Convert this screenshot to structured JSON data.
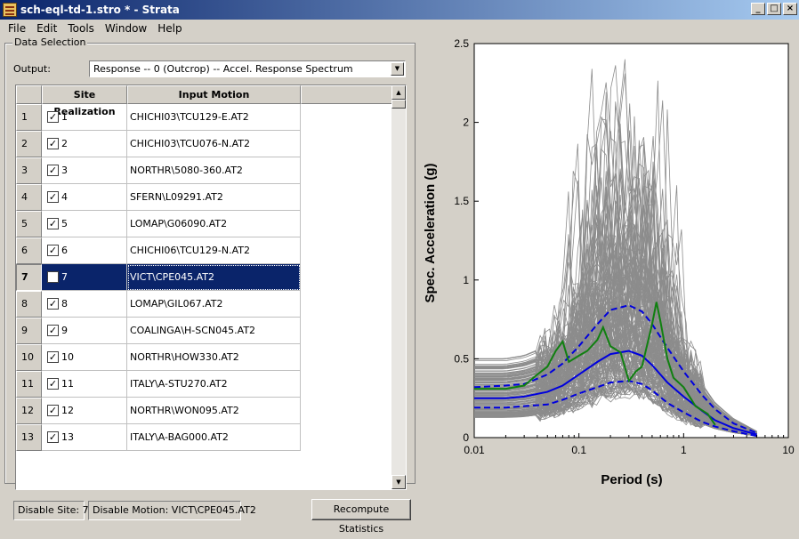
{
  "window": {
    "title": "sch-eql-td-1.stro * - Strata",
    "min": "_",
    "max": "□",
    "close": "×"
  },
  "menu": [
    "File",
    "Edit",
    "Tools",
    "Window",
    "Help"
  ],
  "data_selection": {
    "group_title": "Data Selection",
    "output_label": "Output:",
    "output_value": "Response -- 0 (Outcrop) -- Accel. Response Spectrum",
    "columns": [
      "Site Realization",
      "Input Motion"
    ],
    "rows": [
      {
        "n": "1",
        "site": "1",
        "motion": "CHICHI03\\TCU129-E.AT2",
        "checked": true
      },
      {
        "n": "2",
        "site": "2",
        "motion": "CHICHI03\\TCU076-N.AT2",
        "checked": true
      },
      {
        "n": "3",
        "site": "3",
        "motion": "NORTHR\\5080-360.AT2",
        "checked": true
      },
      {
        "n": "4",
        "site": "4",
        "motion": "SFERN\\L09291.AT2",
        "checked": true
      },
      {
        "n": "5",
        "site": "5",
        "motion": "LOMAP\\G06090.AT2",
        "checked": true
      },
      {
        "n": "6",
        "site": "6",
        "motion": "CHICHI06\\TCU129-N.AT2",
        "checked": true
      },
      {
        "n": "7",
        "site": "7",
        "motion": "VICT\\CPE045.AT2",
        "checked": true,
        "selected": true
      },
      {
        "n": "8",
        "site": "8",
        "motion": "LOMAP\\GIL067.AT2",
        "checked": true
      },
      {
        "n": "9",
        "site": "9",
        "motion": "COALINGA\\H-SCN045.AT2",
        "checked": true
      },
      {
        "n": "10",
        "site": "10",
        "motion": "NORTHR\\HOW330.AT2",
        "checked": true
      },
      {
        "n": "11",
        "site": "11",
        "motion": "ITALY\\A-STU270.AT2",
        "checked": true
      },
      {
        "n": "12",
        "site": "12",
        "motion": "NORTHR\\WON095.AT2",
        "checked": true
      },
      {
        "n": "13",
        "site": "13",
        "motion": "ITALY\\A-BAG000.AT2",
        "checked": true
      }
    ],
    "disable_site": "Disable Site: 7",
    "disable_motion": "Disable Motion: VICT\\CPE045.AT2",
    "recompute_button": "Recompute Statistics"
  },
  "chart_data": {
    "type": "line",
    "xlabel": "Period (s)",
    "ylabel": "Spec. Acceleration (g)",
    "xscale": "log",
    "xlim": [
      0.01,
      10
    ],
    "ylim": [
      0,
      2.5
    ],
    "xticks": [
      "0.01",
      "0.1",
      "1",
      "10"
    ],
    "yticks": [
      "0",
      "0.5",
      "1",
      "1.5",
      "2",
      "2.5"
    ],
    "colors": {
      "realizations": "#8c8c8c",
      "statistics": "#0000dd",
      "selected": "#108010"
    },
    "series": [
      {
        "style": "solid",
        "x": [
          0.01,
          0.02,
          0.03,
          0.05,
          0.07,
          0.1,
          0.15,
          0.2,
          0.3,
          0.4,
          0.5,
          0.7,
          1.0,
          1.5,
          2.0,
          3.0,
          5.0
        ],
        "y": [
          0.25,
          0.25,
          0.26,
          0.29,
          0.33,
          0.4,
          0.48,
          0.53,
          0.55,
          0.52,
          0.46,
          0.35,
          0.26,
          0.17,
          0.11,
          0.06,
          0.02
        ]
      },
      {
        "style": "dashed",
        "x": [
          0.01,
          0.02,
          0.03,
          0.05,
          0.07,
          0.1,
          0.15,
          0.2,
          0.3,
          0.4,
          0.5,
          0.7,
          1.0,
          1.5,
          2.0,
          3.0,
          5.0
        ],
        "y": [
          0.32,
          0.33,
          0.34,
          0.4,
          0.47,
          0.58,
          0.72,
          0.81,
          0.84,
          0.8,
          0.72,
          0.57,
          0.42,
          0.27,
          0.18,
          0.09,
          0.03
        ]
      },
      {
        "style": "dashed",
        "x": [
          0.01,
          0.02,
          0.03,
          0.05,
          0.07,
          0.1,
          0.15,
          0.2,
          0.3,
          0.4,
          0.5,
          0.7,
          1.0,
          1.5,
          2.0,
          3.0,
          5.0
        ],
        "y": [
          0.19,
          0.19,
          0.2,
          0.21,
          0.24,
          0.28,
          0.32,
          0.35,
          0.36,
          0.34,
          0.3,
          0.22,
          0.16,
          0.1,
          0.07,
          0.04,
          0.01
        ]
      },
      {
        "style": "selected",
        "x": [
          0.01,
          0.02,
          0.03,
          0.04,
          0.05,
          0.06,
          0.07,
          0.08,
          0.1,
          0.12,
          0.15,
          0.17,
          0.2,
          0.25,
          0.3,
          0.35,
          0.4,
          0.5,
          0.55,
          0.6,
          0.7,
          0.8,
          1.0,
          1.3,
          1.7,
          2.0
        ],
        "y": [
          0.31,
          0.31,
          0.33,
          0.4,
          0.45,
          0.55,
          0.61,
          0.48,
          0.52,
          0.55,
          0.62,
          0.7,
          0.58,
          0.54,
          0.36,
          0.42,
          0.45,
          0.72,
          0.86,
          0.74,
          0.5,
          0.38,
          0.32,
          0.2,
          0.15,
          0.08
        ]
      }
    ]
  }
}
